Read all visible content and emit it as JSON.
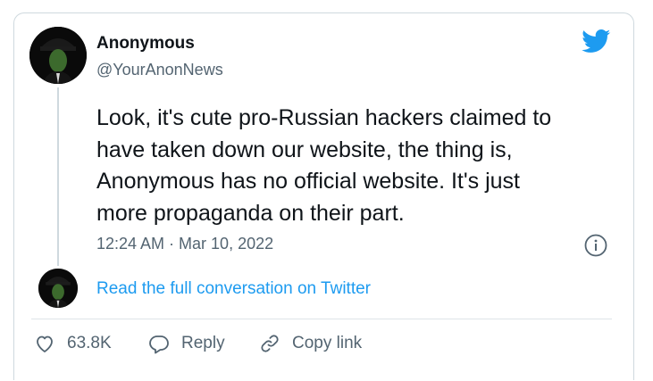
{
  "tweet": {
    "author_name": "Anonymous",
    "author_handle": "@YourAnonNews",
    "lines": [
      "Look, it's cute pro-Russian hackers claimed to",
      "have taken down our website, the thing is,",
      "Anonymous has no official website. It's just",
      "more propaganda on their part."
    ],
    "timestamp": "12:24 AM · Mar 10, 2022",
    "read_conversation_label": "Read the full conversation on Twitter"
  },
  "actions": {
    "like_count": "63.8K",
    "reply_label": "Reply",
    "copy_link_label": "Copy link"
  },
  "icons": {
    "brand": "twitter-bird-icon",
    "info": "info-icon",
    "like": "heart-icon",
    "reply": "comment-icon",
    "copy": "link-icon"
  },
  "colors": {
    "link": "#1d9bf0",
    "brand": "#1d9bf0",
    "secondary_text": "#536471",
    "border": "#cfd9de"
  }
}
